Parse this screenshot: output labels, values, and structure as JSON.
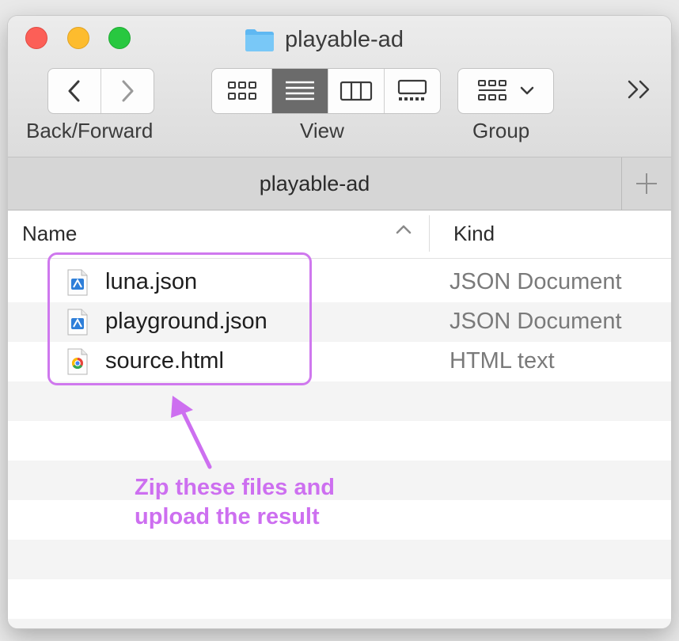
{
  "window": {
    "title": "playable-ad",
    "traffic_lights": [
      "close",
      "minimize",
      "zoom"
    ]
  },
  "toolbar": {
    "navigation": {
      "label": "Back/Forward",
      "back_icon": "chevron-left-icon",
      "forward_icon": "chevron-right-icon"
    },
    "view": {
      "label": "View",
      "modes": [
        {
          "name": "icon-view",
          "icon": "grid-icon",
          "active": false
        },
        {
          "name": "list-view",
          "icon": "list-icon",
          "active": true
        },
        {
          "name": "column-view",
          "icon": "columns-icon",
          "active": false
        },
        {
          "name": "gallery-view",
          "icon": "gallery-icon",
          "active": false
        }
      ]
    },
    "group": {
      "label": "Group",
      "icon": "group-grid-icon",
      "dropdown_icon": "chevron-down-icon"
    },
    "overflow_icon": "double-chevron-right-icon"
  },
  "tabbar": {
    "active_tab": "playable-ad",
    "add_icon": "plus-icon"
  },
  "columns": {
    "name": "Name",
    "kind": "Kind",
    "sort_icon": "chevron-up-icon"
  },
  "files": [
    {
      "name": "luna.json",
      "kind": "JSON Document",
      "icon": "json-file-icon"
    },
    {
      "name": "playground.json",
      "kind": "JSON Document",
      "icon": "json-file-icon"
    },
    {
      "name": "source.html",
      "kind": "HTML text",
      "icon": "html-file-icon"
    }
  ],
  "annotation": {
    "line1": "Zip these files and",
    "line2": "upload the result",
    "color": "#cd6ff0"
  },
  "colors": {
    "close": "#fc5f57",
    "minimize": "#fdbc2e",
    "zoom": "#28c840",
    "folder": "#5fb8f2",
    "highlight": "#cf78ee"
  }
}
